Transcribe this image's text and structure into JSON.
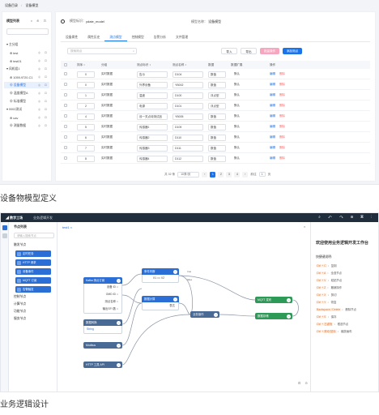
{
  "shot1": {
    "breadcrumb": [
      "设备目录",
      "/",
      "设备模型"
    ],
    "sidebar": {
      "title": "模型列表",
      "tools": "± ⊕ ⊡",
      "search_placeholder": "",
      "items": [
        {
          "label": "▾ 主分组",
          "indent": 0,
          "selected": false,
          "actions": ""
        },
        {
          "label": "⊕ test",
          "indent": 1,
          "selected": false,
          "actions": "◎ ⊡"
        },
        {
          "label": "⊕ test01",
          "indent": 1,
          "selected": false,
          "actions": "◎ ⊡"
        },
        {
          "label": "▾ 风机组1",
          "indent": 0,
          "selected": false,
          "actions": "◎ ⊡"
        },
        {
          "label": "⊕ 1059-9720-C1",
          "indent": 1,
          "selected": false,
          "actions": "◎ ⊡"
        },
        {
          "label": "⊕ 设备模型",
          "indent": 1,
          "selected": true,
          "actions": "◎ ⊡"
        },
        {
          "label": "⊕ 温度模型A",
          "indent": 1,
          "selected": false,
          "actions": "◎ ⊡"
        },
        {
          "label": "⊕ 标准模型",
          "indent": 1,
          "selected": false,
          "actions": "◎ ⊡"
        },
        {
          "label": "▾ 0002测试",
          "indent": 0,
          "selected": false,
          "actions": "◎ ⊡"
        },
        {
          "label": "⊕ uav",
          "indent": 1,
          "selected": false,
          "actions": "◎ ⊡"
        },
        {
          "label": "⊕ 测量数据",
          "indent": 1,
          "selected": false,
          "actions": "◎ ⊡"
        }
      ]
    },
    "header": {
      "id_label": "模型标识：",
      "id_value": "ydate_model",
      "name_label": "模型名称：",
      "name_value": "设备模型"
    },
    "tabs": [
      "设备属性",
      "属性历史",
      "测点模型",
      "控制模型",
      "告警分析",
      "文件管理"
    ],
    "active_tab": 2,
    "search_placeholder": "搜索测点",
    "buttons": {
      "import": "导入",
      "export": "导出",
      "batch": "批量操作",
      "add": "添加测点"
    },
    "columns": [
      "",
      "排序 ↕",
      "分组",
      "测点标识 ↕",
      "测点名称 ↕",
      "数据",
      "数据扩展",
      "操作"
    ],
    "rows": [
      {
        "order": "0",
        "group": "实时数据",
        "ident": "告示",
        "name": "D104",
        "dtype": "数值",
        "ext": "默认",
        "a1": "编辑",
        "a2": "删除"
      },
      {
        "order": "0",
        "group": "实时数据",
        "ident": "外界设备",
        "name": "YB002",
        "dtype": "数值",
        "ext": "默认",
        "a1": "编辑",
        "a2": "删除"
      },
      {
        "order": "1",
        "group": "实时数据",
        "ident": "温度",
        "name": "D100",
        "dtype": "浮点型",
        "ext": "默认",
        "a1": "编辑",
        "a2": "删除"
      },
      {
        "order": "2",
        "group": "实时数据",
        "ident": "电源",
        "name": "D101",
        "dtype": "浮点型",
        "ext": "默认",
        "a1": "编辑",
        "a2": "删除"
      },
      {
        "order": "4",
        "group": "实时数据",
        "ident": "设一关点待测试品",
        "name": "YB005",
        "dtype": "数值",
        "ext": "默认",
        "a1": "编辑",
        "a2": "删除"
      },
      {
        "order": "5",
        "group": "实时数据",
        "ident": "传感器1",
        "name": "D109",
        "dtype": "数值",
        "ext": "默认",
        "a1": "编辑",
        "a2": "删除"
      },
      {
        "order": "6",
        "group": "实时数据",
        "ident": "传感器2",
        "name": "D110",
        "dtype": "数值",
        "ext": "默认",
        "a1": "编辑",
        "a2": "删除"
      },
      {
        "order": "7",
        "group": "实时数据",
        "ident": "传感器3",
        "name": "D111",
        "dtype": "数值",
        "ext": "默认",
        "a1": "编辑",
        "a2": "删除"
      },
      {
        "order": "8",
        "group": "实时数据",
        "ident": "传感器4",
        "name": "D112",
        "dtype": "数值",
        "ext": "默认",
        "a1": "编辑",
        "a2": "删除"
      }
    ],
    "pager": {
      "total": "共 32 条",
      "size": "10条/页",
      "pages": [
        "‹",
        "1",
        "2",
        "3",
        "4",
        "›"
      ],
      "current": "1",
      "goto": "前往",
      "goto_val": "1",
      "goto_suffix": "页"
    },
    "caption": "设备物模型定义"
  },
  "shot2": {
    "logo": "◢ 数字工场",
    "title": "业务逻辑开发",
    "tools": "⌕ ↶ ↷ ⊟ ▣ ⋮",
    "palette": {
      "title": "节点列表",
      "search_placeholder": "请输入搜索节点",
      "groups": [
        {
          "label": "触发节点",
          "kind": "group"
        },
        {
          "label": "定时任务",
          "kind": "node"
        },
        {
          "label": "HTTP 请求",
          "kind": "node"
        },
        {
          "label": "设备事件",
          "kind": "node"
        },
        {
          "label": "MQTT 订阅",
          "kind": "node"
        },
        {
          "label": "告警触发",
          "kind": "node"
        },
        {
          "label": "控制节点",
          "kind": "group"
        },
        {
          "label": "计算节点",
          "kind": "group"
        },
        {
          "label": "功能节点",
          "kind": "group"
        },
        {
          "label": "服务节点",
          "kind": "group"
        }
      ]
    },
    "canvas": {
      "tab": "test1 ×",
      "close": "×",
      "nodes": {
        "source": {
          "title": "Kafka 测点订阅",
          "lines": [
            "设备 ID ○",
            "OMD ID ○",
            "测点名称 ○",
            "输出SFI 数 ○"
          ]
        },
        "loop": {
          "title": "条件判断",
          "lines": [
            "V1  ==  V2"
          ]
        },
        "calc": {
          "title": "数据计算",
          "lines": [
            "表达"
          ]
        },
        "api": {
          "title": "业务操作"
        },
        "func": {
          "title": "数据转换",
          "lines": [
            "String"
          ]
        },
        "mqtt": {
          "title": "MQTT 发布"
        },
        "store": {
          "title": "数据存储"
        },
        "d1": {
          "title": "Modbus"
        },
        "d2": {
          "title": "HTTP 工具 API"
        }
      },
      "edge_labels": {
        "true": "true",
        "false": "false"
      }
    },
    "help": {
      "title": "欢迎使用业务逻辑开发工作台",
      "subtitle": "快捷键说明:",
      "items": [
        {
          "key": "Ctrl + C",
          "desc": "复制"
        },
        {
          "key": "Ctrl + A",
          "desc": "全选节点"
        },
        {
          "key": "Ctrl + V",
          "desc": "粘贴节点"
        },
        {
          "key": "Ctrl + Z",
          "desc": "撤销操作"
        },
        {
          "key": "Ctrl + X",
          "desc": "剪切"
        },
        {
          "key": "Ctrl + Y",
          "desc": "恢复"
        },
        {
          "key": "Backspace / Delete",
          "desc": "删除节点"
        },
        {
          "key": "Ctrl + S",
          "desc": "保存"
        },
        {
          "key": "Ctrl + 左键拖",
          "desc": "框选节点"
        },
        {
          "key": "Ctrl + 滚动/鼠标",
          "desc": "缩放画布"
        }
      ]
    },
    "zoom": "⊡ ⊙",
    "caption": "业务逻辑设计"
  },
  "colors": {
    "primary": "#1a73e8",
    "danger": "#f56c6c",
    "dark_header": "#1f2d3d",
    "node_blue": "#2b6fd6",
    "node_green": "#2e9a57",
    "node_slate": "#4a6a96"
  }
}
